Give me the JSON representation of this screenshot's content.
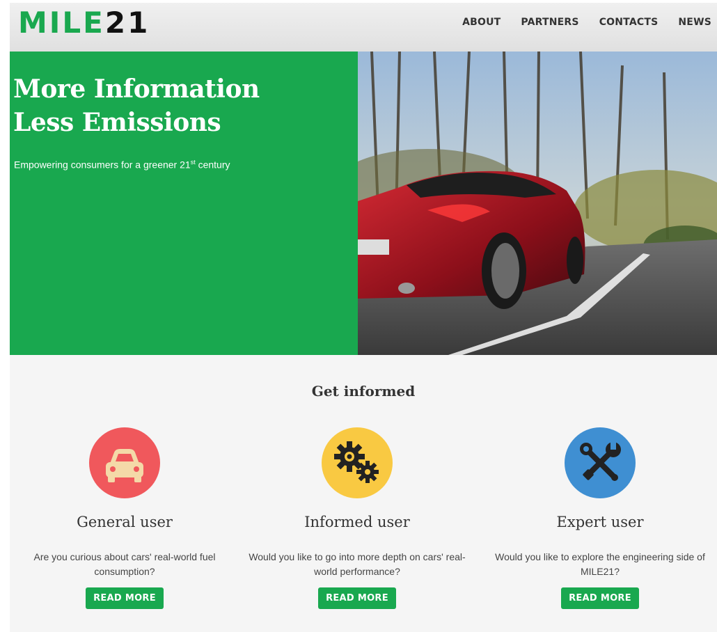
{
  "header": {
    "logo_part1": "MILE",
    "logo_part2": "21",
    "nav": [
      "ABOUT",
      "PARTNERS",
      "CONTACTS",
      "NEWS"
    ]
  },
  "hero": {
    "title_line1": "More Information",
    "title_line2": "Less Emissions",
    "subtitle_pre": "Empowering consumers for a greener 21",
    "subtitle_sup": "st",
    "subtitle_post": " century"
  },
  "info": {
    "title": "Get informed",
    "cards": [
      {
        "title": "General user",
        "desc": "Are you curious about cars' real-world fuel consumption?",
        "button": "READ MORE",
        "icon": "car-icon",
        "color": "#f0585c"
      },
      {
        "title": "Informed user",
        "desc": "Would you like to go into more depth on cars' real-world performance?",
        "button": "READ MORE",
        "icon": "gears-icon",
        "color": "#f9c942"
      },
      {
        "title": "Expert user",
        "desc": "Would you like to explore the engineering side of MILE21?",
        "button": "READ MORE",
        "icon": "tools-icon",
        "color": "#3f8fd2"
      }
    ]
  },
  "colors": {
    "brand_green": "#19a84f",
    "dark": "#111111"
  }
}
